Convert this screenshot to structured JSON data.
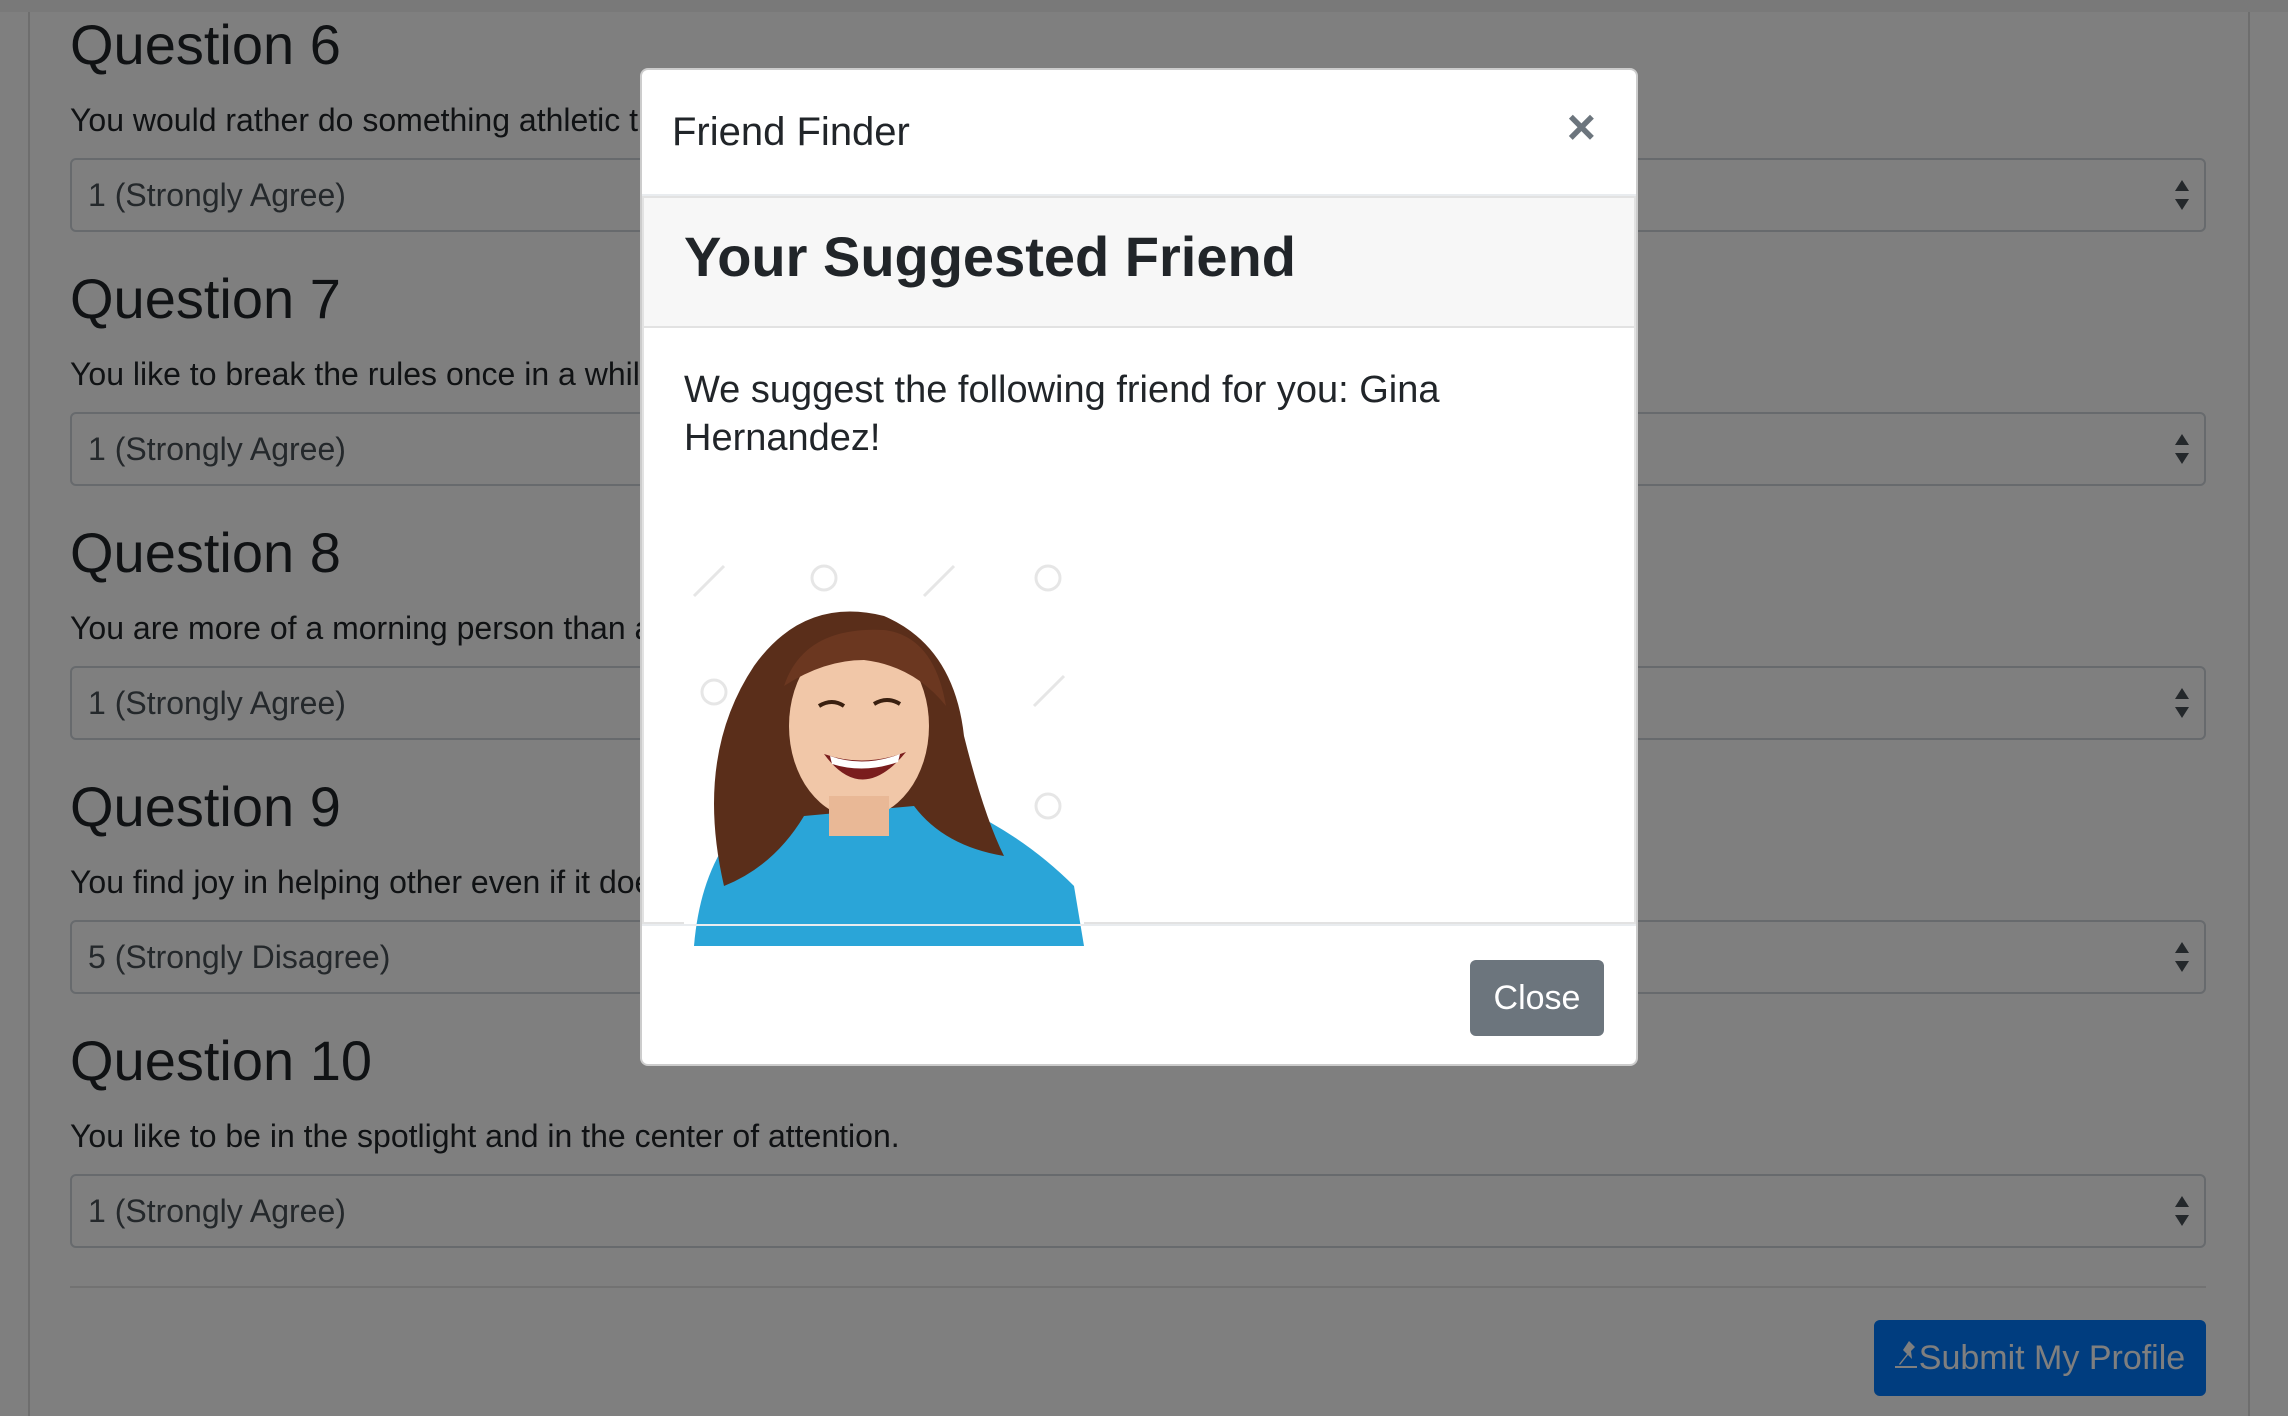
{
  "questions": [
    {
      "title": "Question 6",
      "text": "You would rather do something athletic than sit around reading a book.",
      "selected": "1 (Strongly Agree)"
    },
    {
      "title": "Question 7",
      "text": "You like to break the rules once in a while.",
      "selected": "1 (Strongly Agree)"
    },
    {
      "title": "Question 8",
      "text": "You are more of a morning person than a night owl.",
      "selected": "1 (Strongly Agree)"
    },
    {
      "title": "Question 9",
      "text": "You find joy in helping other even if it doesn't benefit you.",
      "selected": "5 (Strongly Disagree)"
    },
    {
      "title": "Question 10",
      "text": "You like to be in the spotlight and in the center of attention.",
      "selected": "1 (Strongly Agree)"
    }
  ],
  "submit": {
    "label": "Submit My Profile",
    "icon": "pin-icon"
  },
  "modal": {
    "title": "Friend Finder",
    "close_symbol": "×",
    "card_title": "Your Suggested Friend",
    "message": "We suggest the following friend for you: Gina Hernandez!",
    "photo_alt": "Gina Hernandez",
    "close_label": "Close"
  },
  "colors": {
    "primary": "#007bff",
    "secondary": "#6c757d",
    "backdrop": "rgba(0,0,0,0.5)"
  }
}
